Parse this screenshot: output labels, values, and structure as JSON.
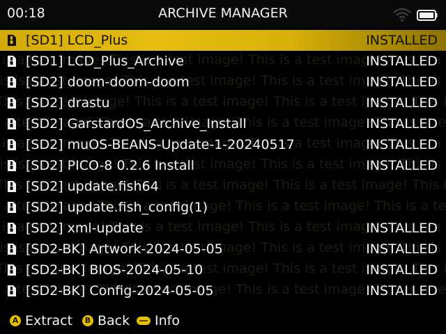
{
  "status_bar": {
    "time": "00:18",
    "title": "ARCHIVE MANAGER",
    "wifi_icon": "wifi-icon",
    "battery_icon": "battery-icon"
  },
  "watermark": {
    "text": "This is a test image! This is a test image! This is a test image! This is a test image! This is a test image!"
  },
  "archives": [
    {
      "name": "[SD1] LCD_Plus",
      "status": "INSTALLED",
      "selected": true
    },
    {
      "name": "[SD1] LCD_Plus_Archive",
      "status": "INSTALLED",
      "selected": false
    },
    {
      "name": "[SD2] doom-doom-doom",
      "status": "INSTALLED",
      "selected": false
    },
    {
      "name": "[SD2] drastu",
      "status": "INSTALLED",
      "selected": false
    },
    {
      "name": "[SD2] GarstardOS_Archive_Install",
      "status": "INSTALLED",
      "selected": false
    },
    {
      "name": "[SD2] muOS-BEANS-Update-1-20240517",
      "status": "INSTALLED",
      "selected": false
    },
    {
      "name": "[SD2] PICO-8 0.2.6 Install",
      "status": "INSTALLED",
      "selected": false
    },
    {
      "name": "[SD2] update.fish64",
      "status": "",
      "selected": false
    },
    {
      "name": "[SD2] update.fish_config(1)",
      "status": "",
      "selected": false
    },
    {
      "name": "[SD2] xml-update",
      "status": "INSTALLED",
      "selected": false
    },
    {
      "name": "[SD2-BK] Artwork-2024-05-05",
      "status": "INSTALLED",
      "selected": false
    },
    {
      "name": "[SD2-BK] BIOS-2024-05-10",
      "status": "INSTALLED",
      "selected": false
    },
    {
      "name": "[SD2-BK] Config-2024-05-05",
      "status": "INSTALLED",
      "selected": false
    }
  ],
  "footer": {
    "a_button": {
      "glyph": "A",
      "label": "Extract"
    },
    "b_button": {
      "glyph": "B",
      "label": "Back"
    },
    "menu_button": {
      "glyph": "menu-pill-icon",
      "label": "Info"
    }
  },
  "colors": {
    "accent": "#e4c000",
    "selection": "#d8b008",
    "background": "#000000",
    "text": "#f2f2f2"
  }
}
